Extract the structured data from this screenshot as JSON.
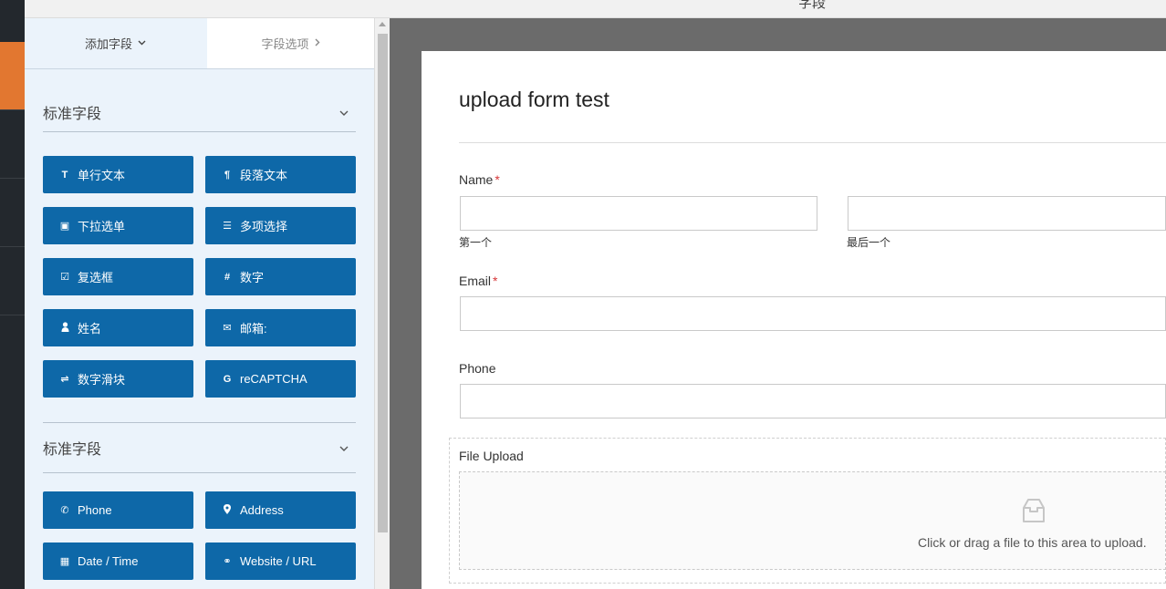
{
  "topbar": {
    "title": "字段"
  },
  "tabs": [
    {
      "label": "添加字段",
      "chevron": "⌄"
    },
    {
      "label": "字段选项",
      "chevron": "›"
    }
  ],
  "sections": [
    {
      "title": "标准字段",
      "buttons": [
        {
          "label": "单行文本",
          "icon": "text-icon",
          "glyph": "T"
        },
        {
          "label": "段落文本",
          "icon": "paragraph-icon",
          "glyph": "¶"
        },
        {
          "label": "下拉选单",
          "icon": "dropdown-icon",
          "glyph": "▣"
        },
        {
          "label": "多项选择",
          "icon": "list-icon",
          "glyph": "☰"
        },
        {
          "label": "复选框",
          "icon": "checkbox-icon",
          "glyph": "☑"
        },
        {
          "label": "数字",
          "icon": "hash-icon",
          "glyph": "#"
        },
        {
          "label": "姓名",
          "icon": "user-icon",
          "glyph": "👤"
        },
        {
          "label": "邮箱:",
          "icon": "envelope-icon",
          "glyph": "✉"
        },
        {
          "label": "数字滑块",
          "icon": "sliders-icon",
          "glyph": "⇌"
        },
        {
          "label": "reCAPTCHA",
          "icon": "google-icon",
          "glyph": "G"
        }
      ]
    },
    {
      "title": "标准字段",
      "buttons": [
        {
          "label": "Phone",
          "icon": "phone-icon",
          "glyph": "✆"
        },
        {
          "label": "Address",
          "icon": "map-marker-icon",
          "glyph": "⚲"
        },
        {
          "label": "Date / Time",
          "icon": "calendar-icon",
          "glyph": "▦"
        },
        {
          "label": "Website / URL",
          "icon": "link-icon",
          "glyph": "⚭"
        }
      ]
    }
  ],
  "form": {
    "title": "upload form test",
    "name_label": "Name",
    "required_mark": "*",
    "first_sublabel": "第一个",
    "last_sublabel": "最后一个",
    "email_label": "Email",
    "phone_label": "Phone",
    "upload_label": "File Upload",
    "upload_text": "Click or drag a file to this area to upload."
  },
  "colors": {
    "button_bg": "#0e68a8",
    "accent_orange": "#e27730",
    "required": "#d63638"
  }
}
